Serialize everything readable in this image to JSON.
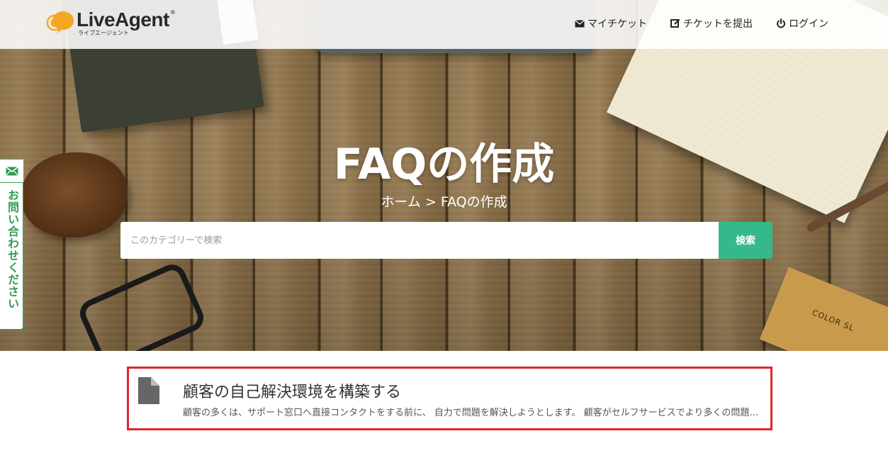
{
  "header": {
    "logo_text": "LiveAgent",
    "logo_registered": "®",
    "logo_subtitle": "ライブエージェント",
    "nav": {
      "my_tickets": "マイチケット",
      "submit_ticket": "チケットを提出",
      "login": "ログイン"
    }
  },
  "hero": {
    "title": "FAQの作成",
    "breadcrumb": {
      "home": "ホーム",
      "separator": ">",
      "current": "FAQの作成"
    },
    "prop_label": "COLOR SL"
  },
  "search": {
    "placeholder": "このカテゴリーで検索",
    "button_label": "検索"
  },
  "contact_tab": {
    "label": "お問い合わせください"
  },
  "articles": [
    {
      "title": "顧客の自己解決環境を構築する",
      "excerpt": "顧客の多くは、サポート窓口へ直接コンタクトをする前に、 自力で問題を解決しようとします。 顧客がセルフサービスでより多くの問題を解決できるように"
    }
  ],
  "colors": {
    "accent_green": "#35b98a",
    "contact_green": "#2f9c4f",
    "logo_orange": "#f5a623",
    "highlight_red": "#e0242f"
  }
}
